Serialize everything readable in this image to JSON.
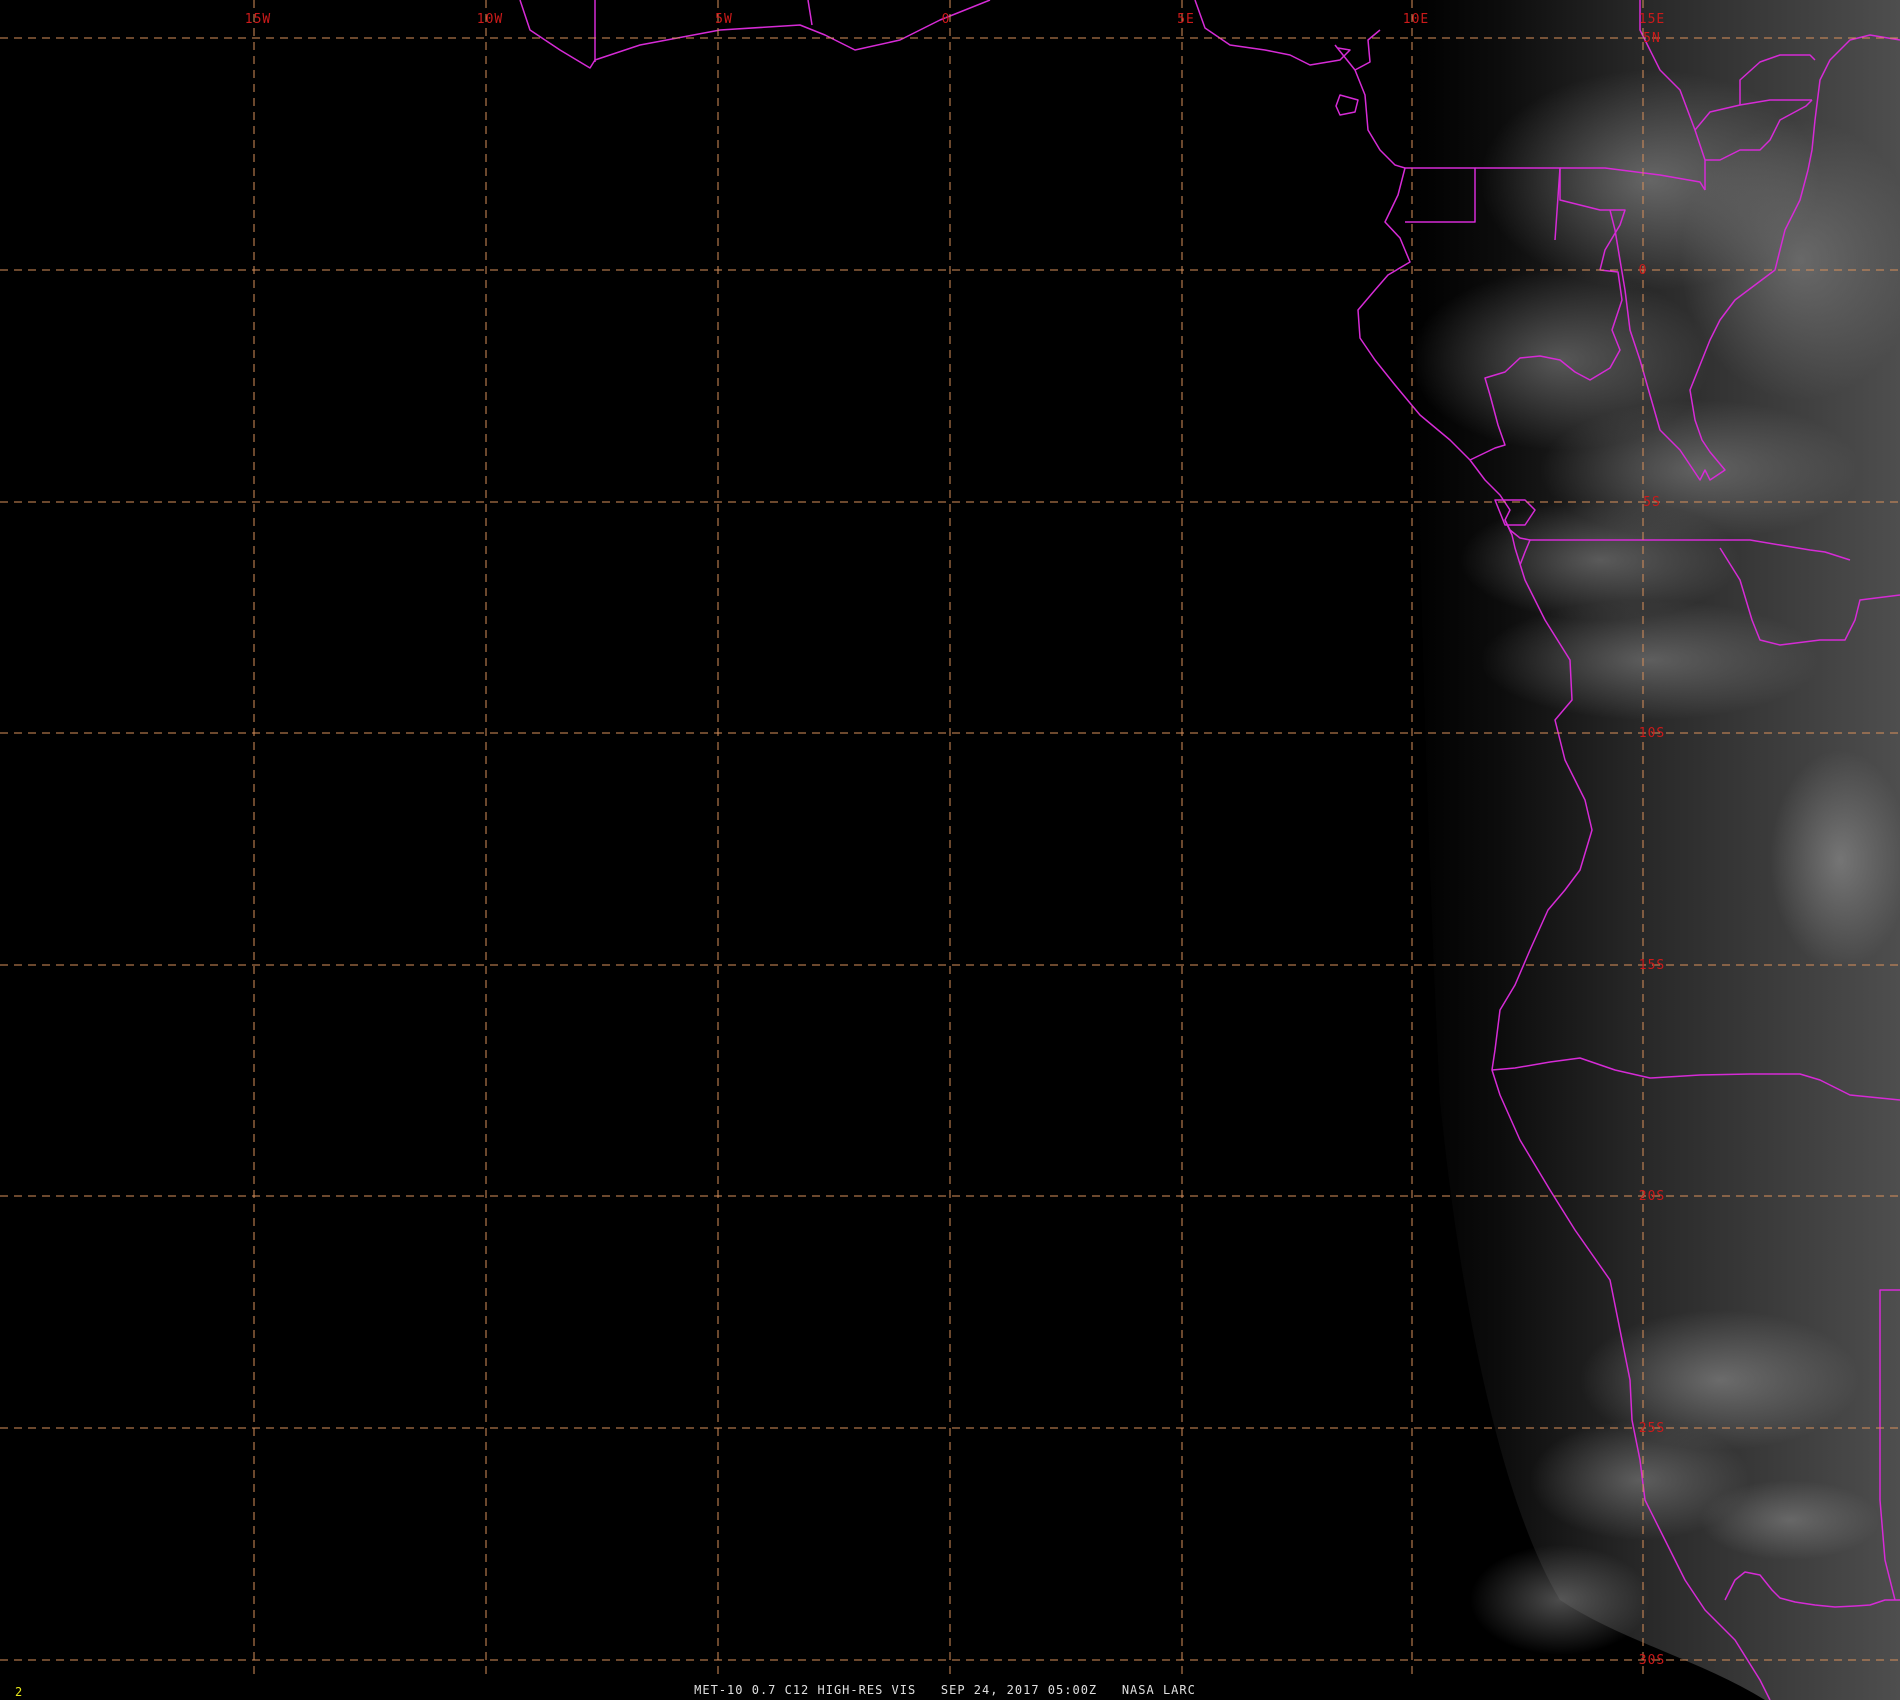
{
  "title_bar": {
    "caption": "MET-10 0.7 C12 HIGH-RES VIS   SEP 24, 2017 05:00Z   NASA LARC",
    "frame_number": "2"
  },
  "grid": {
    "longitude_labels": [
      "15W",
      "10W",
      "5W",
      "0",
      "5E",
      "10E",
      "15E"
    ],
    "latitude_labels": [
      "5N",
      "0",
      "5S",
      "10S",
      "15S",
      "20S",
      "25S",
      "30S"
    ]
  },
  "colors": {
    "background": "#000000",
    "gridline": "#d9905a",
    "grid_label": "#cc1a1a",
    "boundary": "#d62bd6",
    "caption": "#e0e0e0",
    "frame_number": "#e6e61a",
    "land_dark": "#141414",
    "land_light": "#4a4a4a"
  }
}
